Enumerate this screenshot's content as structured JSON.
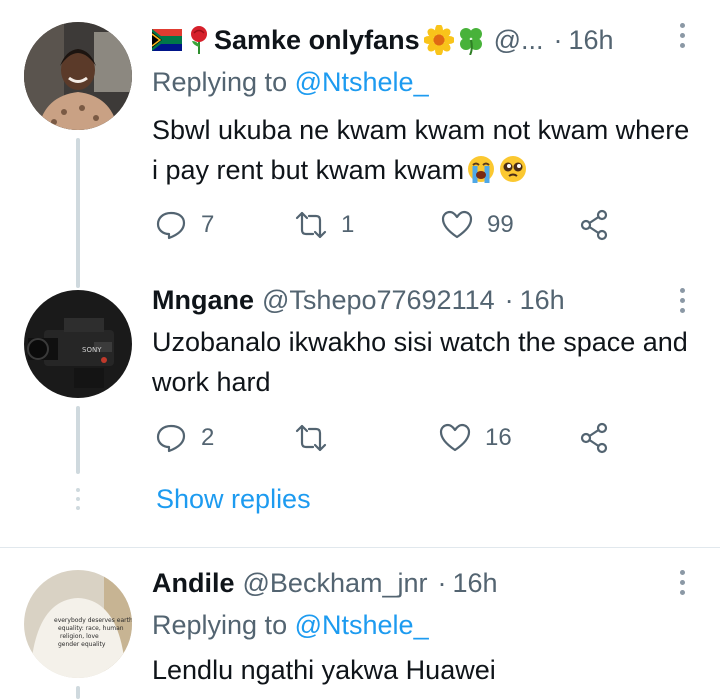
{
  "tweets": [
    {
      "display_name": "Samke onlyfans",
      "handle": "@...",
      "time": "16h",
      "replying_prefix": "Replying to",
      "replying_to": "@Ntshele_",
      "text": "Sbwl ukuba ne kwam kwam not kwam where i pay rent but kwam kwam",
      "replies": "7",
      "retweets": "1",
      "likes": "99"
    },
    {
      "display_name": "Mngane",
      "handle": "@Tshepo77692114",
      "time": "16h",
      "text": "Uzobanalo ikwakho sisi watch the space and work hard",
      "replies": "2",
      "retweets": "",
      "likes": "16"
    },
    {
      "display_name": "Andile",
      "handle": "@Beckham_jnr",
      "time": "16h",
      "replying_prefix": "Replying to",
      "replying_to": "@Ntshele_",
      "text": "Lendlu ngathi yakwa Huawei",
      "avatar_shirt_text": "everybody deserves earth equality: race, human religion, love gender equality"
    }
  ],
  "show_replies_label": "Show replies",
  "dot_separator": "·",
  "colors": {
    "accent": "#1d9bf0",
    "secondary_text": "#536471",
    "thread_line": "#cfd9de"
  },
  "icons": [
    "reply-icon",
    "retweet-icon",
    "like-icon",
    "share-icon",
    "more-options-icon"
  ]
}
